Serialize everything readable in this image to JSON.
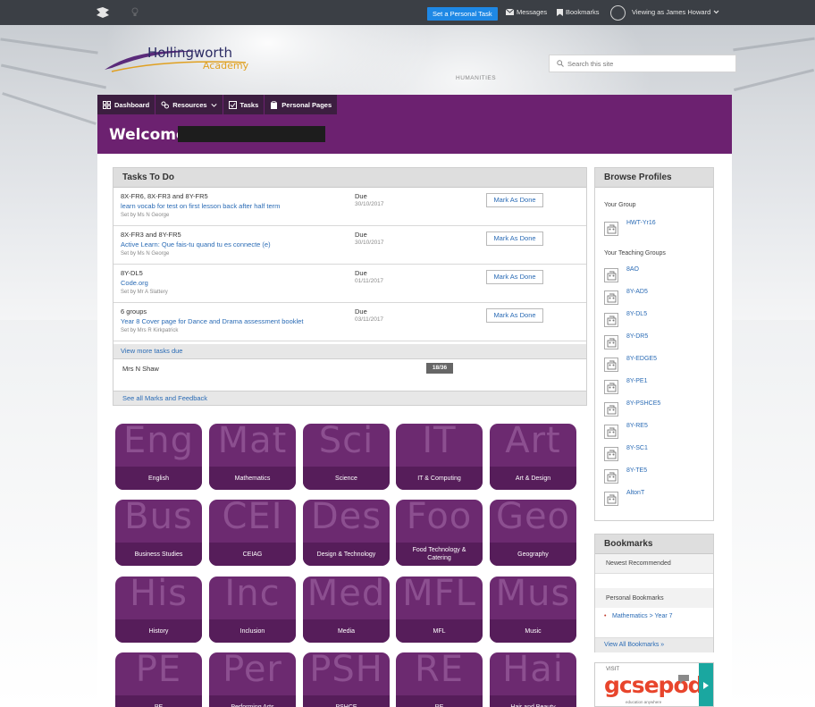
{
  "topbar": {
    "set_task_label": "Set a Personal Task",
    "messages_label": "Messages",
    "bookmarks_label": "Bookmarks",
    "viewing_as": "Viewing as James Howard"
  },
  "school": {
    "name": "Hollingworth",
    "subname": "Academy"
  },
  "search": {
    "placeholder": "Search this site"
  },
  "background_sign": "HUMANITIES",
  "nav": {
    "dashboard": "Dashboard",
    "resources": "Resources",
    "tasks": "Tasks",
    "personal_pages": "Personal Pages"
  },
  "welcome": "Welcome, .",
  "tasks": {
    "heading": "Tasks To Do",
    "items": [
      {
        "groups": "8X-FR6, 8X-FR3 and 8Y-FR5",
        "title": "learn vocab for test on first lesson back after half term",
        "set_by": "Set by Ms N George",
        "due_label": "Due",
        "due_date": "30/10/2017",
        "button": "Mark As Done"
      },
      {
        "groups": "8X-FR3 and 8Y-FR5",
        "title": "Active Learn: Que fais-tu quand tu es connecte (e)",
        "set_by": "Set by Ms N George",
        "due_label": "Due",
        "due_date": "30/10/2017",
        "button": "Mark As Done"
      },
      {
        "groups": "8Y-DL5",
        "title": "Code.org",
        "set_by": "Set by Mr A Slattery",
        "due_label": "Due",
        "due_date": "01/11/2017",
        "button": "Mark As Done"
      },
      {
        "groups": "6 groups",
        "title": "Year 8 Cover page for Dance and Drama assessment booklet",
        "set_by": "Set by Mrs R Kirkpatrick",
        "due_label": "Due",
        "due_date": "03/11/2017",
        "button": "Mark As Done"
      }
    ],
    "view_more": "View more tasks due"
  },
  "marks": {
    "teacher": "Mrs N Shaw",
    "score": "18/36",
    "see_all": "See all Marks and Feedback"
  },
  "subjects": [
    {
      "abbr": "Eng",
      "name": "English"
    },
    {
      "abbr": "Mat",
      "name": "Mathematics"
    },
    {
      "abbr": "Sci",
      "name": "Science"
    },
    {
      "abbr": "IT",
      "name": "IT & Computing"
    },
    {
      "abbr": "Art",
      "name": "Art & Design"
    },
    {
      "abbr": "Bus",
      "name": "Business Studies"
    },
    {
      "abbr": "CEI",
      "name": "CEIAG"
    },
    {
      "abbr": "Des",
      "name": "Design & Technology"
    },
    {
      "abbr": "Foo",
      "name": "Food Technology & Catering"
    },
    {
      "abbr": "Geo",
      "name": "Geography"
    },
    {
      "abbr": "His",
      "name": "History"
    },
    {
      "abbr": "Inc",
      "name": "Inclusion"
    },
    {
      "abbr": "Med",
      "name": "Media"
    },
    {
      "abbr": "MFL",
      "name": "MFL"
    },
    {
      "abbr": "Mus",
      "name": "Music"
    },
    {
      "abbr": "PE",
      "name": "PE"
    },
    {
      "abbr": "Per",
      "name": "Performing Arts"
    },
    {
      "abbr": "PSH",
      "name": "PSHCE"
    },
    {
      "abbr": "RE",
      "name": "RE"
    },
    {
      "abbr": "Hai",
      "name": "Hair and Beauty"
    }
  ],
  "profiles": {
    "heading": "Browse Profiles",
    "your_group_label": "Your Group",
    "your_group": "HWT-Yr16",
    "teaching_label": "Your Teaching Groups",
    "teaching_groups": [
      "8AO",
      "8Y-AD5",
      "8Y-DL5",
      "8Y-DR5",
      "8Y-EDGE5",
      "8Y-PE1",
      "8Y-PSHCE5",
      "8Y-RE5",
      "8Y-SC1",
      "8Y-TE5",
      "AltonT"
    ]
  },
  "bookmarks": {
    "heading": "Bookmarks",
    "newest": "Newest Recommended",
    "personal": "Personal Bookmarks",
    "item": "Mathematics > Year 7",
    "view_all": "View All Bookmarks »"
  },
  "ad": {
    "visit": "VISIT",
    "brand": "gcsepod",
    "tagline": "education anywhere"
  },
  "colors": {
    "purple": "#6c2170",
    "nav_dark": "#3c1e40",
    "tile": "#6c2a70",
    "link": "#2a6bb5",
    "task_button": "#1e88e5"
  }
}
